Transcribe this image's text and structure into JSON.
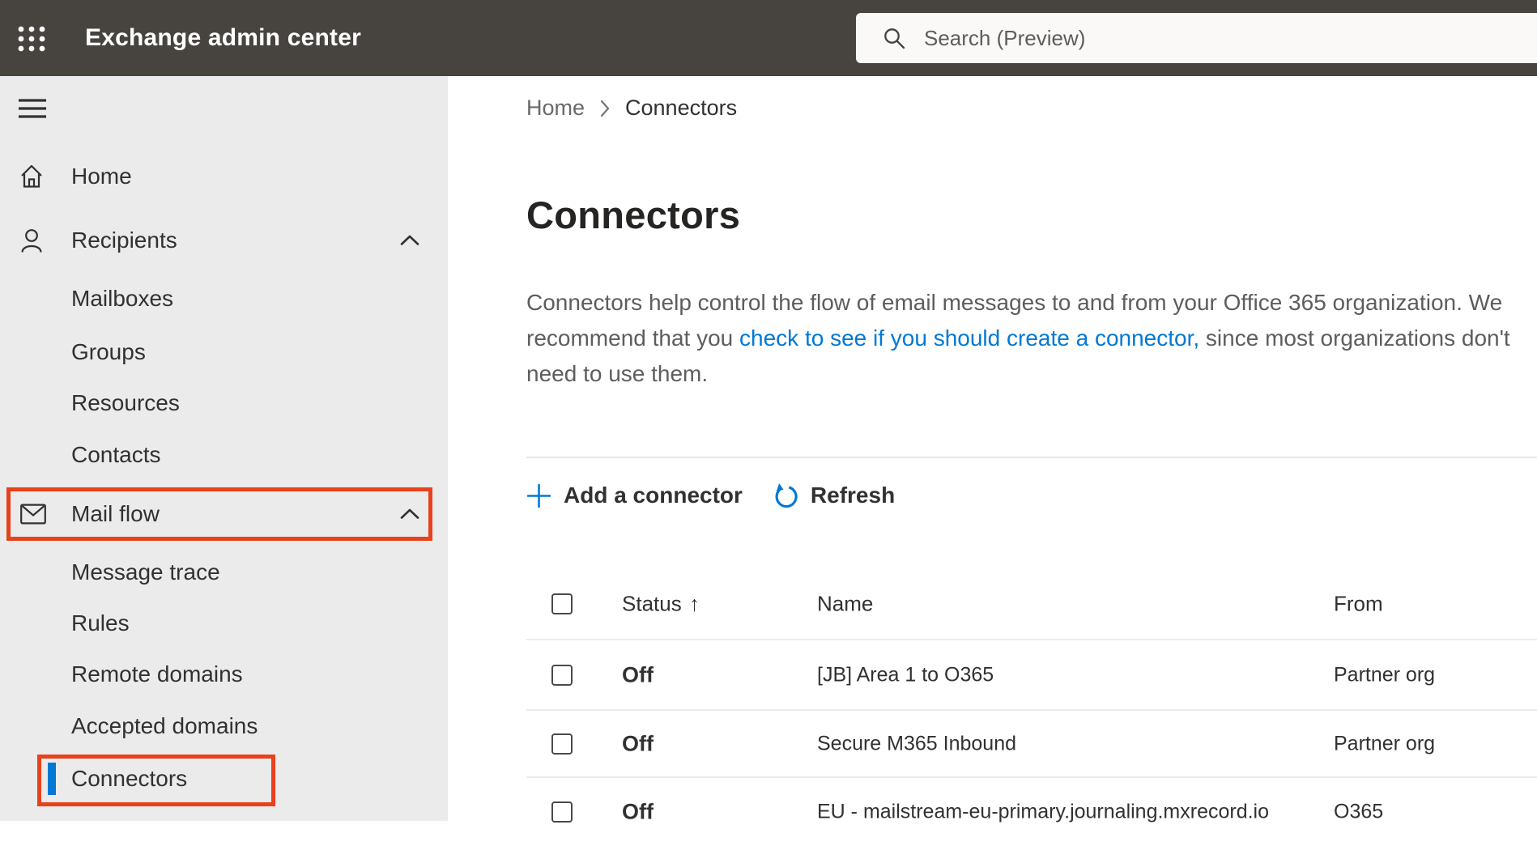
{
  "topbar": {
    "app_title": "Exchange admin center",
    "search_placeholder": "Search (Preview)"
  },
  "sidebar": {
    "items": [
      {
        "label": "Home",
        "icon": "home-icon",
        "level": 0
      },
      {
        "label": "Recipients",
        "icon": "person-icon",
        "level": 0,
        "expanded": true
      },
      {
        "label": "Mailboxes",
        "level": 1
      },
      {
        "label": "Groups",
        "level": 1
      },
      {
        "label": "Resources",
        "level": 1
      },
      {
        "label": "Contacts",
        "level": 1
      },
      {
        "label": "Mail flow",
        "icon": "mail-icon",
        "level": 0,
        "expanded": true,
        "annotated": true
      },
      {
        "label": "Message trace",
        "level": 1
      },
      {
        "label": "Rules",
        "level": 1
      },
      {
        "label": "Remote domains",
        "level": 1
      },
      {
        "label": "Accepted domains",
        "level": 1
      },
      {
        "label": "Connectors",
        "level": 1,
        "selected": true,
        "annotated": true
      }
    ]
  },
  "breadcrumb": {
    "home": "Home",
    "current": "Connectors"
  },
  "page": {
    "title": "Connectors",
    "desc_before": "Connectors help control the flow of email messages to and from your Office 365 organization. We recommend that you ",
    "desc_link": "check to see if you should create a connector,",
    "desc_after": " since most organizations don't need to use them."
  },
  "toolbar": {
    "add": "Add a connector",
    "refresh": "Refresh"
  },
  "table": {
    "headers": {
      "status": "Status",
      "name": "Name",
      "from": "From"
    },
    "sort_column": "Status",
    "sort_indicator": "↑",
    "rows": [
      {
        "status": "Off",
        "name": "[JB] Area 1 to O365",
        "from": "Partner org"
      },
      {
        "status": "Off",
        "name": "Secure M365 Inbound",
        "from": "Partner org"
      },
      {
        "status": "Off",
        "name": "EU - mailstream-eu-primary.journaling.mxrecord.io",
        "from": "O365"
      }
    ]
  },
  "colors": {
    "topbar": "#474440",
    "sidebar_bg": "#ebebeb",
    "annotation_red": "#e8411c",
    "accent_blue": "#0078d4",
    "text_dark": "#323130",
    "text_gray": "#5f5d5b"
  }
}
